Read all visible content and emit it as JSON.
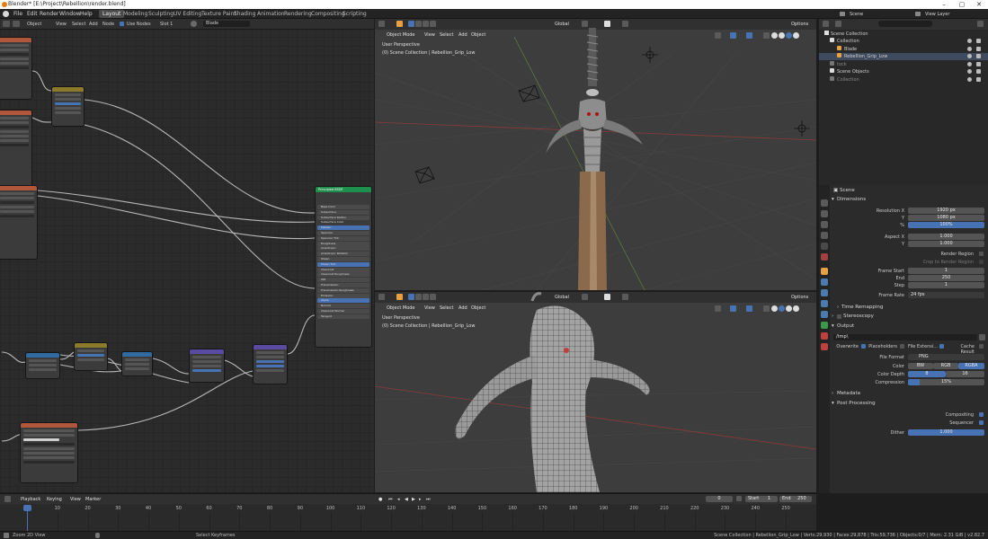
{
  "window": {
    "title": "Blender* [E:\\Project\\Rebellion\\render.blend]",
    "controls": [
      "–",
      "▢",
      "✕"
    ]
  },
  "menubar": {
    "items": [
      "File",
      "Edit",
      "Render",
      "Window",
      "Help"
    ],
    "workspaces": [
      "Layout",
      "Modeling",
      "Sculpting",
      "UV Editing",
      "Texture Paint",
      "Shading",
      "Animation",
      "Rendering",
      "Compositing",
      "Scripting"
    ],
    "active_workspace": "Layout",
    "scene": "Scene",
    "view_layer": "View Layer"
  },
  "node_editor": {
    "object_mode": "Object",
    "menus": [
      "View",
      "Select",
      "Add",
      "Node"
    ],
    "use_nodes": "Use Nodes",
    "slot": "Slot 1",
    "material": "Blade",
    "nodes": [
      {
        "title": "Principled BSDF",
        "header_color": "#1f8f4e"
      },
      {
        "title": "Mapping",
        "header_color": "#8a7a2a"
      },
      {
        "title": "Bump",
        "header_color": "#5a4aa0"
      },
      {
        "title": "Normal Map",
        "header_color": "#5a4aa0"
      },
      {
        "title": "Blade_Grip_Height",
        "header_color": "#b0563a"
      }
    ],
    "principled_inputs": [
      "Base Color",
      "Subsurface",
      "Subsurface Radius",
      "Subsurface Color",
      "Metallic",
      "Specular",
      "Specular Tint",
      "Roughness",
      "Anisotropic",
      "Anisotropic Rotation",
      "Sheen",
      "Sheen Tint",
      "Clearcoat",
      "Clearcoat Roughness",
      "IOR",
      "Transmission",
      "Transmission Roughness",
      "Emission",
      "Alpha",
      "Normal",
      "Clearcoat Normal",
      "Tangent"
    ]
  },
  "viewport_top": {
    "mode": "Object Mode",
    "menus": [
      "View",
      "Select",
      "Add",
      "Object"
    ],
    "orientation": "Global",
    "options": "Options",
    "perspective": "User Perspective",
    "collection": "(0) Scene Collection | Rebellion_Grip_Low"
  },
  "viewport_bottom": {
    "mode": "Object Mode",
    "menus": [
      "View",
      "Select",
      "Add",
      "Object"
    ],
    "orientation": "Global",
    "options": "Options",
    "perspective": "User Perspective",
    "collection": "(0) Scene Collection | Rebellion_Grip_Low"
  },
  "outliner": {
    "root": "Scene Collection",
    "rows": [
      {
        "label": "Collection",
        "indent": 1
      },
      {
        "label": "Blade",
        "indent": 2
      },
      {
        "label": "Rebellion_Grip_Low",
        "indent": 2
      },
      {
        "label": "tock",
        "indent": 1
      },
      {
        "label": "Scene Objects",
        "indent": 1
      },
      {
        "label": "Collection",
        "indent": 1
      }
    ]
  },
  "properties": {
    "context": "Scene",
    "dimensions": {
      "section": "Dimensions",
      "resolution_x_label": "Resolution X",
      "resolution_x": "1920 px",
      "y_label": "Y",
      "resolution_y": "1080 px",
      "percent_label": "%",
      "percent": "100%",
      "aspect_x_label": "Aspect X",
      "aspect_x": "1.000",
      "aspect_y_label": "Y",
      "aspect_y": "1.000",
      "render_region": "Render Region",
      "crop": "Crop to Render Region",
      "frame_start_label": "Frame Start",
      "frame_start": "1",
      "end_label": "End",
      "end": "250",
      "step_label": "Step",
      "step": "1",
      "frame_rate_label": "Frame Rate",
      "frame_rate": "24 fps"
    },
    "time_remapping": "Time Remapping",
    "stereoscopy": "Stereoscopy",
    "output": {
      "section": "Output",
      "path": "/tmp\\",
      "overwrite": "Overwrite",
      "placeholders": "Placeholders",
      "file_extensions": "File Extensi...",
      "cache_result": "Cache Result",
      "file_format_label": "File Format",
      "file_format": "PNG",
      "color_label": "Color",
      "color_options": [
        "BW",
        "RGB",
        "RGBA"
      ],
      "color_selected": "RGBA",
      "color_depth_label": "Color Depth",
      "depth_options": [
        "8",
        "16"
      ],
      "depth_selected": "8",
      "compression_label": "Compression",
      "compression": "15%",
      "compression_value": 0.15
    },
    "metadata": "Metadata",
    "post_processing": {
      "section": "Post Processing",
      "compositing": "Compositing",
      "sequencer": "Sequencer",
      "dither_label": "Dither",
      "dither": "1.000"
    }
  },
  "timeline": {
    "menus": [
      "Playback",
      "Keying",
      "View",
      "Marker"
    ],
    "current_frame": "0",
    "start_label": "Start",
    "start": "1",
    "end_label": "End",
    "end": "250",
    "ticks": [
      "0",
      "10",
      "20",
      "30",
      "40",
      "50",
      "60",
      "70",
      "80",
      "90",
      "100",
      "110",
      "120",
      "130",
      "140",
      "150",
      "160",
      "170",
      "180",
      "190",
      "200",
      "210",
      "220",
      "230",
      "240",
      "250"
    ]
  },
  "statusbar": {
    "left": "Zoom 2D View",
    "middle": "Select Keyframes",
    "right": "Scene Collection | Rebellion_Grip_Low | Verts:29,930 | Faces:29,878 | Tris:59,736 | Objects:0/7 | Mem: 2.31 GiB | v2.82.7"
  },
  "colors": {
    "accent": "#4772b3",
    "active_object": "#e8a040",
    "node_bg": "#2b2b2b",
    "viewport_bg": "#3d3d3d"
  }
}
